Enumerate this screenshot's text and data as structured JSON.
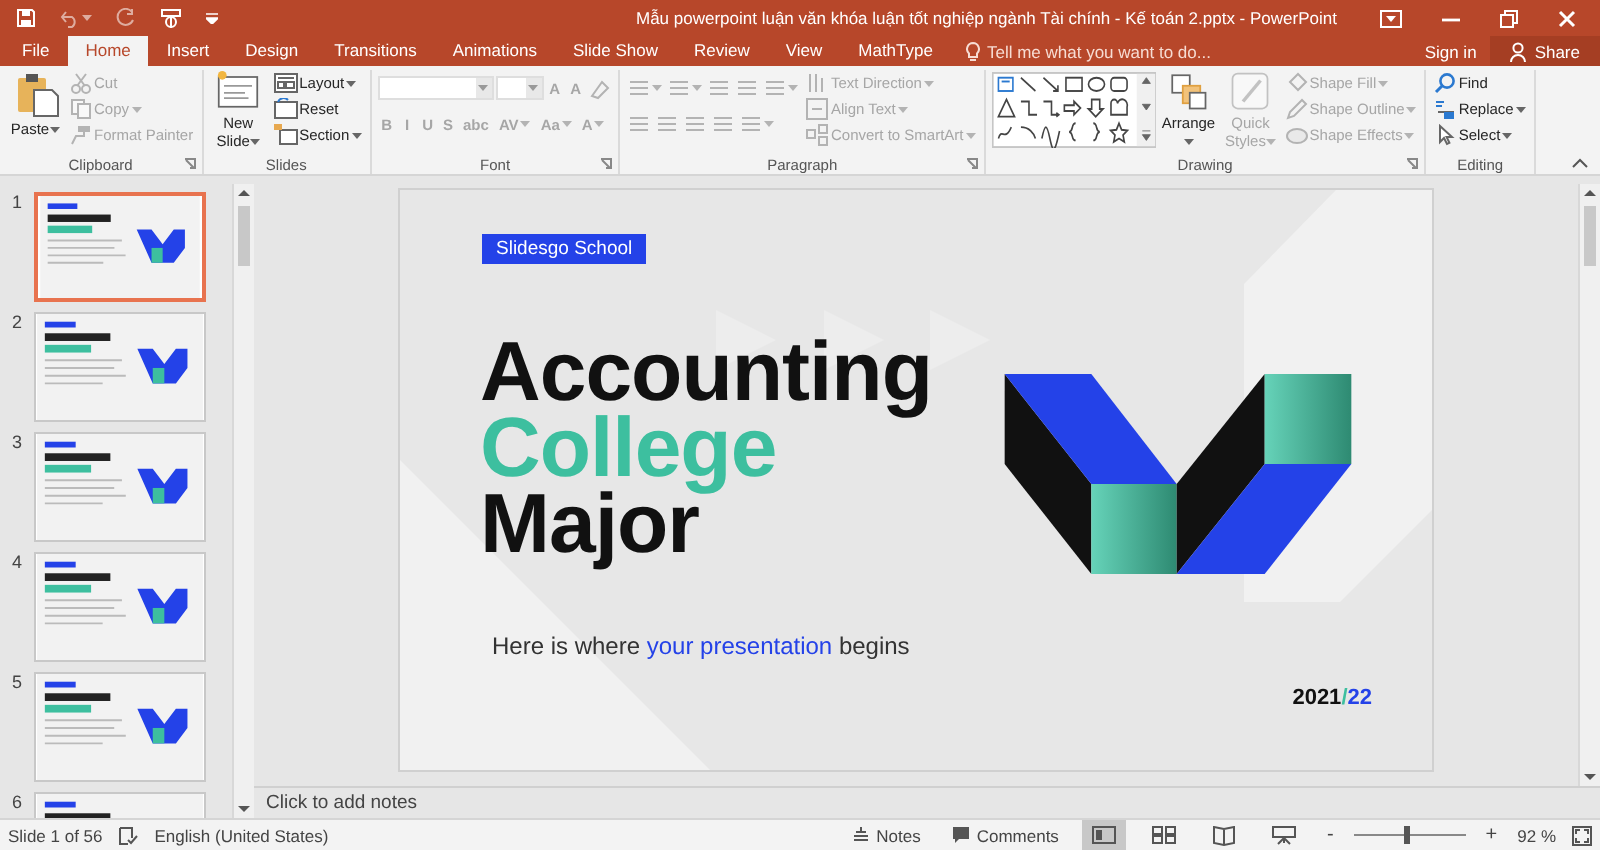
{
  "window": {
    "title": "Mẫu powerpoint luận văn khóa luận tốt nghiệp ngành Tài chính - Kế toán 2.pptx - PowerPoint"
  },
  "tabs": [
    {
      "label": "File",
      "selected": false
    },
    {
      "label": "Home",
      "selected": true
    },
    {
      "label": "Insert",
      "selected": false
    },
    {
      "label": "Design",
      "selected": false
    },
    {
      "label": "Transitions",
      "selected": false
    },
    {
      "label": "Animations",
      "selected": false
    },
    {
      "label": "Slide Show",
      "selected": false
    },
    {
      "label": "Review",
      "selected": false
    },
    {
      "label": "View",
      "selected": false
    },
    {
      "label": "MathType",
      "selected": false
    }
  ],
  "tell_me": {
    "placeholder": "Tell me what you want to do..."
  },
  "account": {
    "sign_in": "Sign in",
    "share": "Share"
  },
  "ribbon": [
    {
      "name": "Clipboard",
      "launcher": true,
      "columns": [
        {
          "kind": "stack",
          "items": [
            {
              "kind": "large",
              "label": "Paste",
              "disabled": false,
              "menu": true
            }
          ]
        },
        {
          "kind": "stack",
          "items": [
            {
              "kind": "small",
              "label": "Cut",
              "disabled": true,
              "menu": false
            },
            {
              "kind": "small",
              "label": "Copy",
              "disabled": true,
              "menu": true
            },
            {
              "kind": "small",
              "label": "Format Painter",
              "disabled": true,
              "menu": false
            }
          ]
        }
      ]
    },
    {
      "name": "Slides",
      "launcher": false,
      "columns": [
        {
          "kind": "stack",
          "items": [
            {
              "kind": "large",
              "label": "New Slide",
              "disabled": false,
              "menu": true
            }
          ]
        },
        {
          "kind": "stack",
          "items": [
            {
              "kind": "small",
              "label": "Layout",
              "disabled": false,
              "menu": true
            },
            {
              "kind": "small",
              "label": "Reset",
              "disabled": false,
              "menu": false
            },
            {
              "kind": "small",
              "label": "Section",
              "disabled": false,
              "menu": true
            }
          ]
        }
      ]
    },
    {
      "name": "Font",
      "launcher": true,
      "columns": [
        {
          "kind": "rows",
          "rows": [
            {
              "items": [
                {
                  "kind": "combo",
                  "disabled": true,
                  "menu": true
                },
                {
                  "kind": "combo_small",
                  "disabled": true,
                  "menu": true
                },
                {
                  "kind": "glyph",
                  "label": "A",
                  "disabled": true,
                  "menu": false
                },
                {
                  "kind": "glyph",
                  "label": "A",
                  "disabled": true,
                  "menu": false
                },
                {
                  "kind": "icon",
                  "disabled": true,
                  "menu": false
                }
              ]
            },
            {
              "items": [
                {
                  "kind": "glyph",
                  "label": "B",
                  "disabled": true,
                  "menu": false
                },
                {
                  "kind": "glyph",
                  "label": "I",
                  "disabled": true,
                  "menu": false
                },
                {
                  "kind": "glyph",
                  "label": "U",
                  "disabled": true,
                  "menu": false
                },
                {
                  "kind": "glyph",
                  "label": "S",
                  "disabled": true,
                  "menu": false
                },
                {
                  "kind": "glyph",
                  "label": "abc",
                  "disabled": true,
                  "menu": false
                },
                {
                  "kind": "glyph",
                  "label": "AV",
                  "disabled": true,
                  "menu": true
                },
                {
                  "kind": "glyph",
                  "label": "Aa",
                  "disabled": true,
                  "menu": true
                },
                {
                  "kind": "glyph",
                  "label": "A",
                  "disabled": true,
                  "menu": true
                }
              ]
            }
          ]
        }
      ]
    },
    {
      "name": "Paragraph",
      "launcher": true,
      "columns": [
        {
          "kind": "rows",
          "rows": [
            {
              "items": [
                {
                  "kind": "icon",
                  "disabled": true,
                  "menu": true
                },
                {
                  "kind": "icon",
                  "disabled": true,
                  "menu": true
                },
                {
                  "kind": "icon",
                  "disabled": true,
                  "menu": false
                },
                {
                  "kind": "icon",
                  "disabled": true,
                  "menu": false
                },
                {
                  "kind": "icon",
                  "disabled": true,
                  "menu": true
                }
              ]
            },
            {
              "items": [
                {
                  "kind": "icon",
                  "disabled": true,
                  "menu": false
                },
                {
                  "kind": "icon",
                  "disabled": true,
                  "menu": false
                },
                {
                  "kind": "icon",
                  "disabled": true,
                  "menu": false
                },
                {
                  "kind": "icon",
                  "disabled": true,
                  "menu": false
                },
                {
                  "kind": "icon",
                  "disabled": true,
                  "menu": true
                }
              ]
            }
          ]
        },
        {
          "kind": "stack",
          "items": [
            {
              "kind": "small",
              "label": "Text Direction",
              "disabled": true,
              "menu": true
            },
            {
              "kind": "small",
              "label": "Align Text",
              "disabled": true,
              "menu": true
            },
            {
              "kind": "small",
              "label": "Convert to SmartArt",
              "disabled": true,
              "menu": true
            }
          ]
        }
      ]
    },
    {
      "name": "Drawing",
      "launcher": true,
      "columns": [
        {
          "kind": "stack",
          "items": [
            {
              "kind": "gallery",
              "disabled": false,
              "menu": true
            }
          ]
        },
        {
          "kind": "stack",
          "items": [
            {
              "kind": "large",
              "label": "Arrange",
              "disabled": false,
              "menu": true
            }
          ]
        },
        {
          "kind": "stack",
          "items": [
            {
              "kind": "large",
              "label": "Quick Styles",
              "disabled": true,
              "menu": true
            }
          ]
        },
        {
          "kind": "stack",
          "items": [
            {
              "kind": "small",
              "label": "Shape Fill",
              "disabled": true,
              "menu": true
            },
            {
              "kind": "small",
              "label": "Shape Outline",
              "disabled": true,
              "menu": true
            },
            {
              "kind": "small",
              "label": "Shape Effects",
              "disabled": true,
              "menu": true
            }
          ]
        }
      ]
    },
    {
      "name": "Editing",
      "launcher": false,
      "columns": [
        {
          "kind": "stack",
          "items": [
            {
              "kind": "small",
              "label": "Find",
              "disabled": false,
              "menu": false
            },
            {
              "kind": "small",
              "label": "Replace",
              "disabled": false,
              "menu": true
            },
            {
              "kind": "small",
              "label": "Select",
              "disabled": false,
              "menu": true
            }
          ]
        }
      ]
    }
  ],
  "slides": [
    {
      "number": "1",
      "selected": true
    },
    {
      "number": "2",
      "selected": false
    },
    {
      "number": "3",
      "selected": false
    },
    {
      "number": "4",
      "selected": false
    },
    {
      "number": "5",
      "selected": false
    },
    {
      "number": "6",
      "selected": false
    }
  ],
  "slide": {
    "badge": "Slidesgo School",
    "title": [
      {
        "text": "Accounting",
        "accent": false
      },
      {
        "text": "College",
        "accent": true
      },
      {
        "text": "Major",
        "accent": false
      }
    ],
    "subtitle": [
      {
        "text": "Here is where ",
        "accent": false
      },
      {
        "text": "your presentation",
        "accent": true
      },
      {
        "text": " begins",
        "accent": false
      }
    ],
    "year": [
      {
        "text": "2021",
        "color": "#111111"
      },
      {
        "text": "/",
        "color": "#3dbf9f"
      },
      {
        "text": "22",
        "color": "#2442e8"
      }
    ]
  },
  "notes": {
    "placeholder": "Click to add notes"
  },
  "status_bar": {
    "slide": "Slide 1 of 56",
    "language": "English (United States)",
    "notes": "Notes",
    "comments": "Comments",
    "views": [
      {
        "selected": true
      },
      {
        "selected": false
      },
      {
        "selected": false
      },
      {
        "selected": false
      }
    ],
    "zoom_out": "-",
    "zoom_in": "+",
    "zoom": {
      "level": 0.46
    },
    "zoom_reading": "92 %"
  }
}
